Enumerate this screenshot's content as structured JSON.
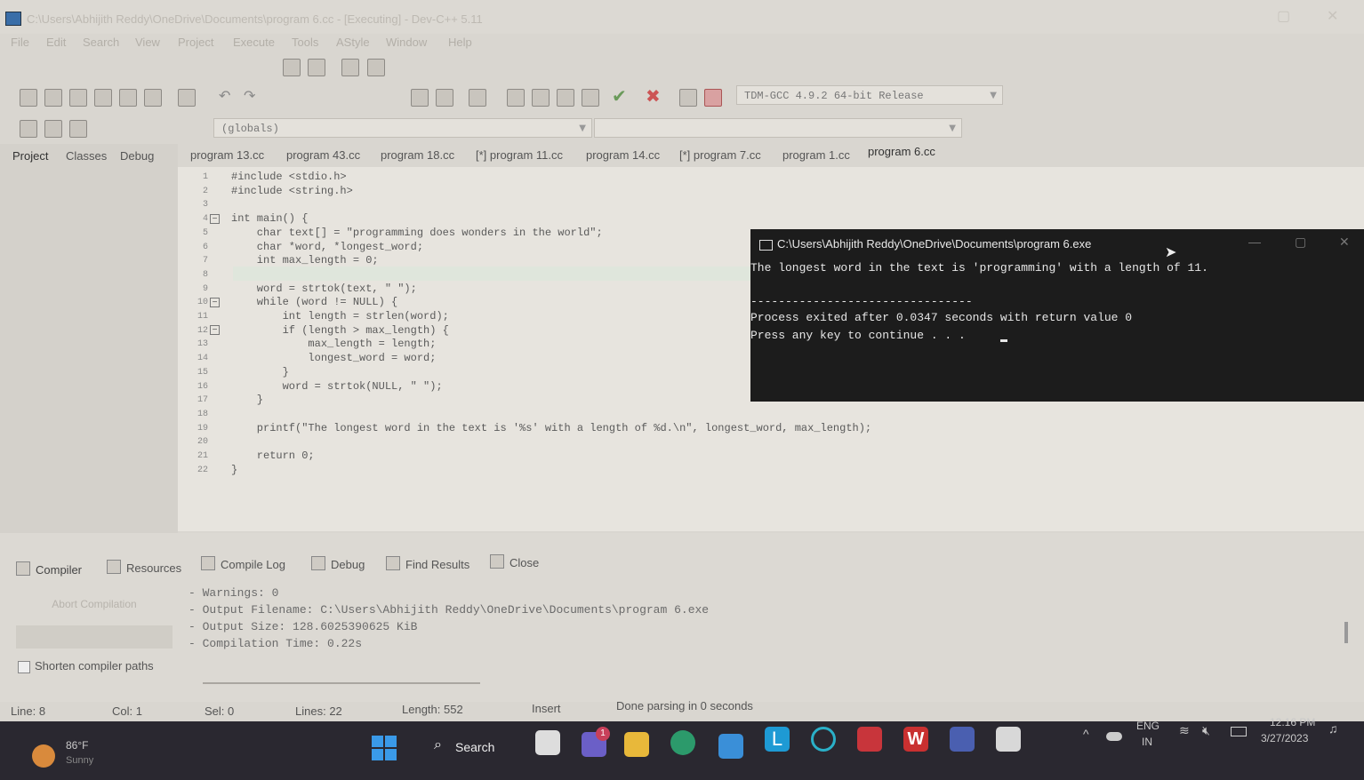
{
  "window": {
    "title": "C:\\Users\\Abhijith Reddy\\OneDrive\\Documents\\program 6.cc - [Executing] - Dev-C++ 5.11"
  },
  "menu": [
    "File",
    "Edit",
    "Search",
    "View",
    "Project",
    "Execute",
    "Tools",
    "AStyle",
    "Window",
    "Help"
  ],
  "toolbar": {
    "compiler_select": "TDM-GCC 4.9.2 64-bit Release",
    "scope_select": "(globals)"
  },
  "left_panel": {
    "tabs": [
      "Project",
      "Classes",
      "Debug"
    ]
  },
  "editor": {
    "tabs": [
      "program 13.cc",
      "program 43.cc",
      "program 18.cc",
      "[*] program 11.cc",
      "program 14.cc",
      "[*] program 7.cc",
      "program 1.cc",
      "program 6.cc"
    ],
    "active_tab": "program 6.cc",
    "lines": [
      "#include <stdio.h>",
      "#include <string.h>",
      "",
      "int main() {",
      "    char text[] = \"programming does wonders in the world\";",
      "    char *word, *longest_word;",
      "    int max_length = 0;",
      "",
      "    word = strtok(text, \" \");",
      "    while (word != NULL) {",
      "        int length = strlen(word);",
      "        if (length > max_length) {",
      "            max_length = length;",
      "            longest_word = word;",
      "        }",
      "        word = strtok(NULL, \" \");",
      "    }",
      "",
      "    printf(\"The longest word in the text is '%s' with a length of %d.\\n\", longest_word, max_length);",
      "",
      "    return 0;",
      "}"
    ]
  },
  "console": {
    "title": "C:\\Users\\Abhijith Reddy\\OneDrive\\Documents\\program 6.exe",
    "lines": [
      "The longest word in the text is 'programming' with a length of 11.",
      "",
      "--------------------------------",
      "Process exited after 0.0347 seconds with return value 0",
      "Press any key to continue . . . "
    ]
  },
  "bottom_panel": {
    "tabs": [
      "Compiler",
      "Resources",
      "Compile Log",
      "Debug",
      "Find Results",
      "Close"
    ],
    "abort_button": "Abort Compilation",
    "shorten_paths": "Shorten compiler paths",
    "output": [
      "- Warnings: 0",
      "- Output Filename: C:\\Users\\Abhijith Reddy\\OneDrive\\Documents\\program 6.exe",
      "- Output Size: 128.6025390625 KiB",
      "- Compilation Time: 0.22s"
    ]
  },
  "status": {
    "line_label": "Line:",
    "line": "8",
    "col_label": "Col:",
    "col": "1",
    "sel_label": "Sel:",
    "sel": "0",
    "lines_label": "Lines:",
    "lines": "22",
    "length_label": "Length:",
    "length": "552",
    "mode": "Insert",
    "message": "Done parsing in 0 seconds"
  },
  "taskbar": {
    "weather_temp": "86°F",
    "weather_desc": "Sunny",
    "search": "Search",
    "chat_badge": "1",
    "lang1": "ENG",
    "lang2": "IN",
    "time": "12:16 PM",
    "date": "3/27/2023"
  },
  "colors": {
    "console_bg": "#1c1c1c",
    "taskbar_bg": "#2a2830",
    "string": "#6a6fb0"
  }
}
